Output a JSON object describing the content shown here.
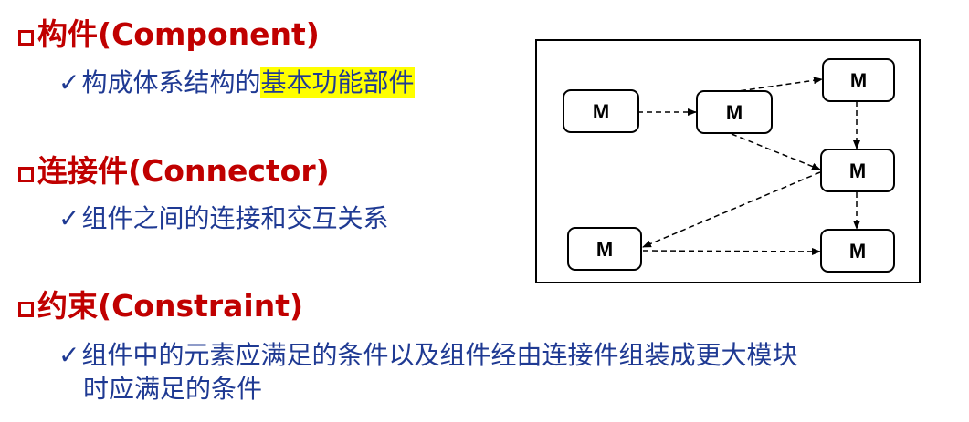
{
  "sections": [
    {
      "heading": "构件(Component)",
      "item_before": "构成体系结构的",
      "item_highlight": "基本功能部件"
    },
    {
      "heading": "连接件(Connector)",
      "item": "组件之间的连接和交互关系"
    },
    {
      "heading": "约束(Constraint)",
      "item_line1": "组件中的元素应满足的条件以及组件经由连接件组装成更大模块",
      "item_line2": "时应满足的条件"
    }
  ],
  "diagram": {
    "modules": [
      "M",
      "M",
      "M",
      "M",
      "M",
      "M"
    ]
  },
  "colors": {
    "heading": "#c00000",
    "body_text": "#1f3a93",
    "highlight": "#ffff00"
  }
}
